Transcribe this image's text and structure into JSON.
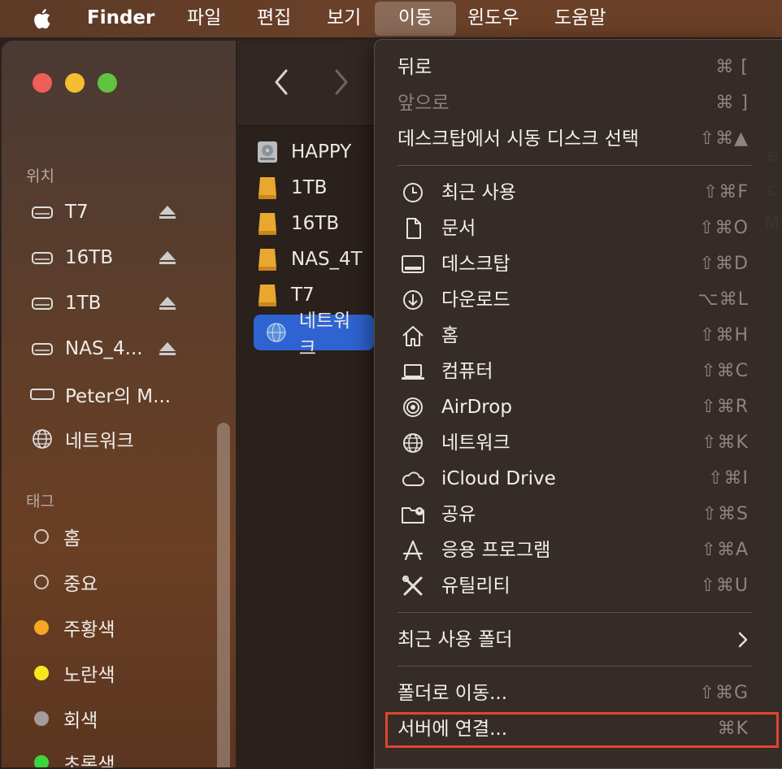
{
  "menubar": {
    "app_name": "Finder",
    "items": [
      "파일",
      "편집",
      "보기",
      "이동",
      "윈도우",
      "도움말"
    ],
    "active_item": "이동"
  },
  "sidebar": {
    "locations_header": "위치",
    "locations": [
      {
        "label": "T7",
        "icon": "external-drive-icon",
        "eject": true
      },
      {
        "label": "16TB",
        "icon": "external-drive-icon",
        "eject": true
      },
      {
        "label": "1TB",
        "icon": "external-drive-icon",
        "eject": true
      },
      {
        "label": "NAS_4...",
        "icon": "external-drive-icon",
        "eject": true
      },
      {
        "label": "Peter의 M...",
        "icon": "computer-icon",
        "eject": false
      },
      {
        "label": "네트워크",
        "icon": "network-globe-icon",
        "eject": false
      }
    ],
    "tags_header": "태그",
    "tags": [
      {
        "label": "홈",
        "color": "none"
      },
      {
        "label": "중요",
        "color": "none"
      },
      {
        "label": "주황색",
        "color": "#f5a623"
      },
      {
        "label": "노란색",
        "color": "#f8e71c"
      },
      {
        "label": "회색",
        "color": "#a39c99"
      },
      {
        "label": "초록색",
        "color": "#3fd43f"
      }
    ]
  },
  "files": [
    {
      "label": "HAPPY",
      "icon": "hard-drive-icon"
    },
    {
      "label": "1TB",
      "icon": "volume-icon"
    },
    {
      "label": "16TB",
      "icon": "volume-icon"
    },
    {
      "label": "NAS_4T",
      "icon": "volume-icon"
    },
    {
      "label": "T7",
      "icon": "volume-icon"
    },
    {
      "label": "네트워크",
      "icon": "network-globe-icon",
      "selected": true
    }
  ],
  "right_edge_glimpses": [
    "e",
    "c",
    "M"
  ],
  "menu": {
    "back": {
      "label": "뒤로",
      "shortcut": "⌘ ["
    },
    "forward": {
      "label": "앞으로",
      "shortcut": "⌘ ]"
    },
    "startup_disk": {
      "label": "데스크탑에서 시동 디스크 선택",
      "shortcut": "⇧⌘▲"
    },
    "places": [
      {
        "label": "최근 사용",
        "shortcut": "⇧⌘F",
        "icon": "clock-icon"
      },
      {
        "label": "문서",
        "shortcut": "⇧⌘O",
        "icon": "document-icon"
      },
      {
        "label": "데스크탑",
        "shortcut": "⇧⌘D",
        "icon": "desktop-icon"
      },
      {
        "label": "다운로드",
        "shortcut": "⌥⌘L",
        "icon": "download-icon"
      },
      {
        "label": "홈",
        "shortcut": "⇧⌘H",
        "icon": "home-icon"
      },
      {
        "label": "컴퓨터",
        "shortcut": "⇧⌘C",
        "icon": "laptop-icon"
      },
      {
        "label": "AirDrop",
        "shortcut": "⇧⌘R",
        "icon": "airdrop-icon"
      },
      {
        "label": "네트워크",
        "shortcut": "⇧⌘K",
        "icon": "network-globe-icon"
      },
      {
        "label": "iCloud Drive",
        "shortcut": "⇧⌘I",
        "icon": "cloud-icon"
      },
      {
        "label": "공유",
        "shortcut": "⇧⌘S",
        "icon": "shared-folder-icon"
      },
      {
        "label": "응용 프로그램",
        "shortcut": "⇧⌘A",
        "icon": "applications-icon"
      },
      {
        "label": "유틸리티",
        "shortcut": "⇧⌘U",
        "icon": "utilities-icon"
      }
    ],
    "recent_folders": {
      "label": "최근 사용 폴더"
    },
    "go_to_folder": {
      "label": "폴더로 이동...",
      "shortcut": "⇧⌘G"
    },
    "connect_to_server": {
      "label": "서버에 연결...",
      "shortcut": "⌘K"
    }
  },
  "colors": {
    "highlight": "#e0452f",
    "selection": "#2e63d1"
  }
}
